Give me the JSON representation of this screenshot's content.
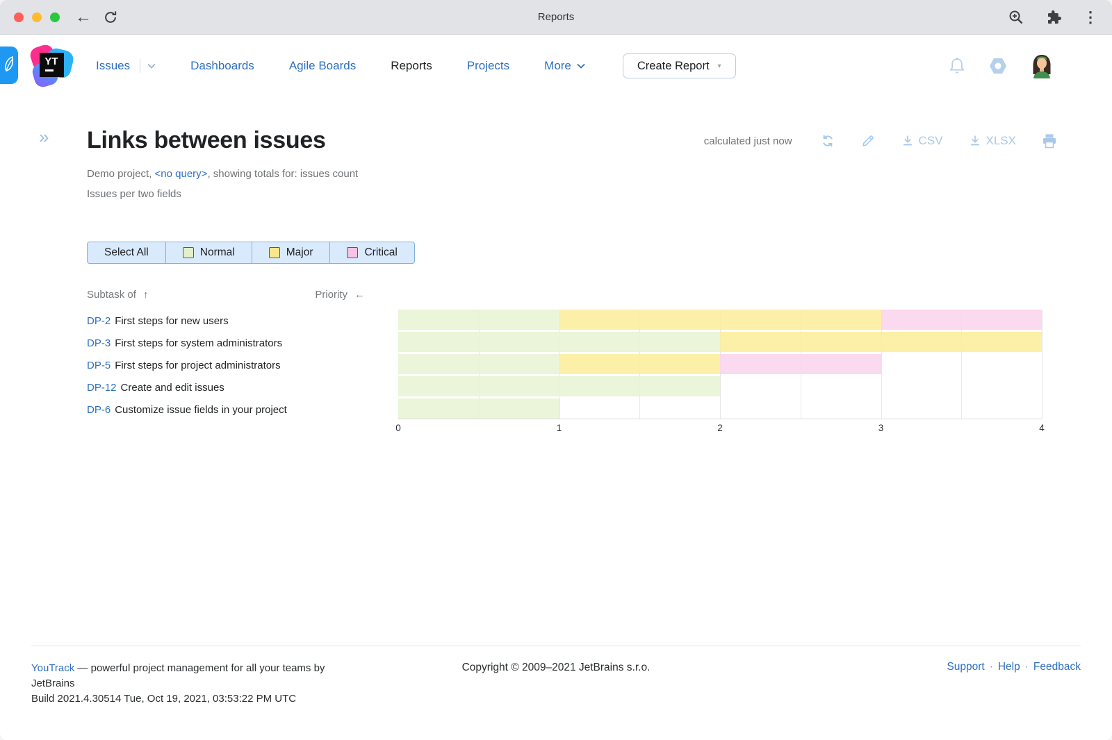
{
  "browser": {
    "title": "Reports",
    "back_icon": "←",
    "kebab_icon": "⋮"
  },
  "app_header": {
    "nav": [
      {
        "label": "Issues"
      },
      {
        "label": "Dashboards"
      },
      {
        "label": "Agile Boards"
      },
      {
        "label": "Reports"
      },
      {
        "label": "Projects"
      },
      {
        "label": "More"
      }
    ],
    "create_report_label": "Create Report",
    "create_report_caret": "▾"
  },
  "report_header": {
    "collapse_icon": "»",
    "title": "Links between issues",
    "subtitle_project": "Demo project, ",
    "subtitle_query": "<no query>",
    "subtitle_rest": ", showing totals for: issues count",
    "subtitle_line2": "Issues per two fields",
    "calculated": "calculated just now",
    "csv_label": "CSV",
    "xlsx_label": "XLSX"
  },
  "filters": {
    "select_all": "Select All",
    "options": [
      {
        "label": "Normal",
        "swatch": "#e3f0c9"
      },
      {
        "label": "Major",
        "swatch": "#f8e88d"
      },
      {
        "label": "Critical",
        "swatch": "#f7c3e4"
      }
    ]
  },
  "columns": {
    "rows_field": "Subtask of",
    "rows_sort_icon": "↑",
    "cols_field": "Priority",
    "cols_sort_icon": "←"
  },
  "rows": [
    {
      "id": "DP-2",
      "title": "First steps for new users"
    },
    {
      "id": "DP-3",
      "title": "First steps for system administrators"
    },
    {
      "id": "DP-5",
      "title": "First steps for project administrators"
    },
    {
      "id": "DP-12",
      "title": "Create and edit issues"
    },
    {
      "id": "DP-6",
      "title": "Customize issue fields in your project"
    }
  ],
  "chart_data": {
    "type": "bar",
    "orientation": "horizontal",
    "stacked": true,
    "title": "Links between issues",
    "xlabel": "issues count",
    "ylabel": "Subtask of",
    "categories": [
      "DP-2 First steps for new users",
      "DP-3 First steps for system administrators",
      "DP-5 First steps for project administrators",
      "DP-12 Create and edit issues",
      "DP-6 Customize issue fields in your project"
    ],
    "series": [
      {
        "name": "Normal",
        "color": "rgba(230,243,210,0.85)",
        "values": [
          1,
          2,
          1,
          2,
          1
        ]
      },
      {
        "name": "Major",
        "color": "rgba(251,237,153,0.85)",
        "values": [
          2,
          2,
          1,
          0,
          0
        ]
      },
      {
        "name": "Critical",
        "color": "rgba(250,210,235,0.85)",
        "values": [
          1,
          0,
          1,
          0,
          0
        ]
      }
    ],
    "xlim": [
      0,
      4
    ],
    "x_ticks": [
      0,
      1,
      2,
      3,
      4
    ],
    "gridline_step": 0.5,
    "grid": true,
    "legend_position": "top-left-filter-bar"
  },
  "footer": {
    "left_link": "YouTrack",
    "left_rest": " — powerful project management for all your teams by JetBrains",
    "build": "Build 2021.4.30514 Tue, Oct 19, 2021, 03:53:22 PM UTC",
    "copyright": "Copyright © 2009–2021 JetBrains s.r.o.",
    "links": [
      "Support",
      "Help",
      "Feedback"
    ],
    "separator": "·"
  }
}
